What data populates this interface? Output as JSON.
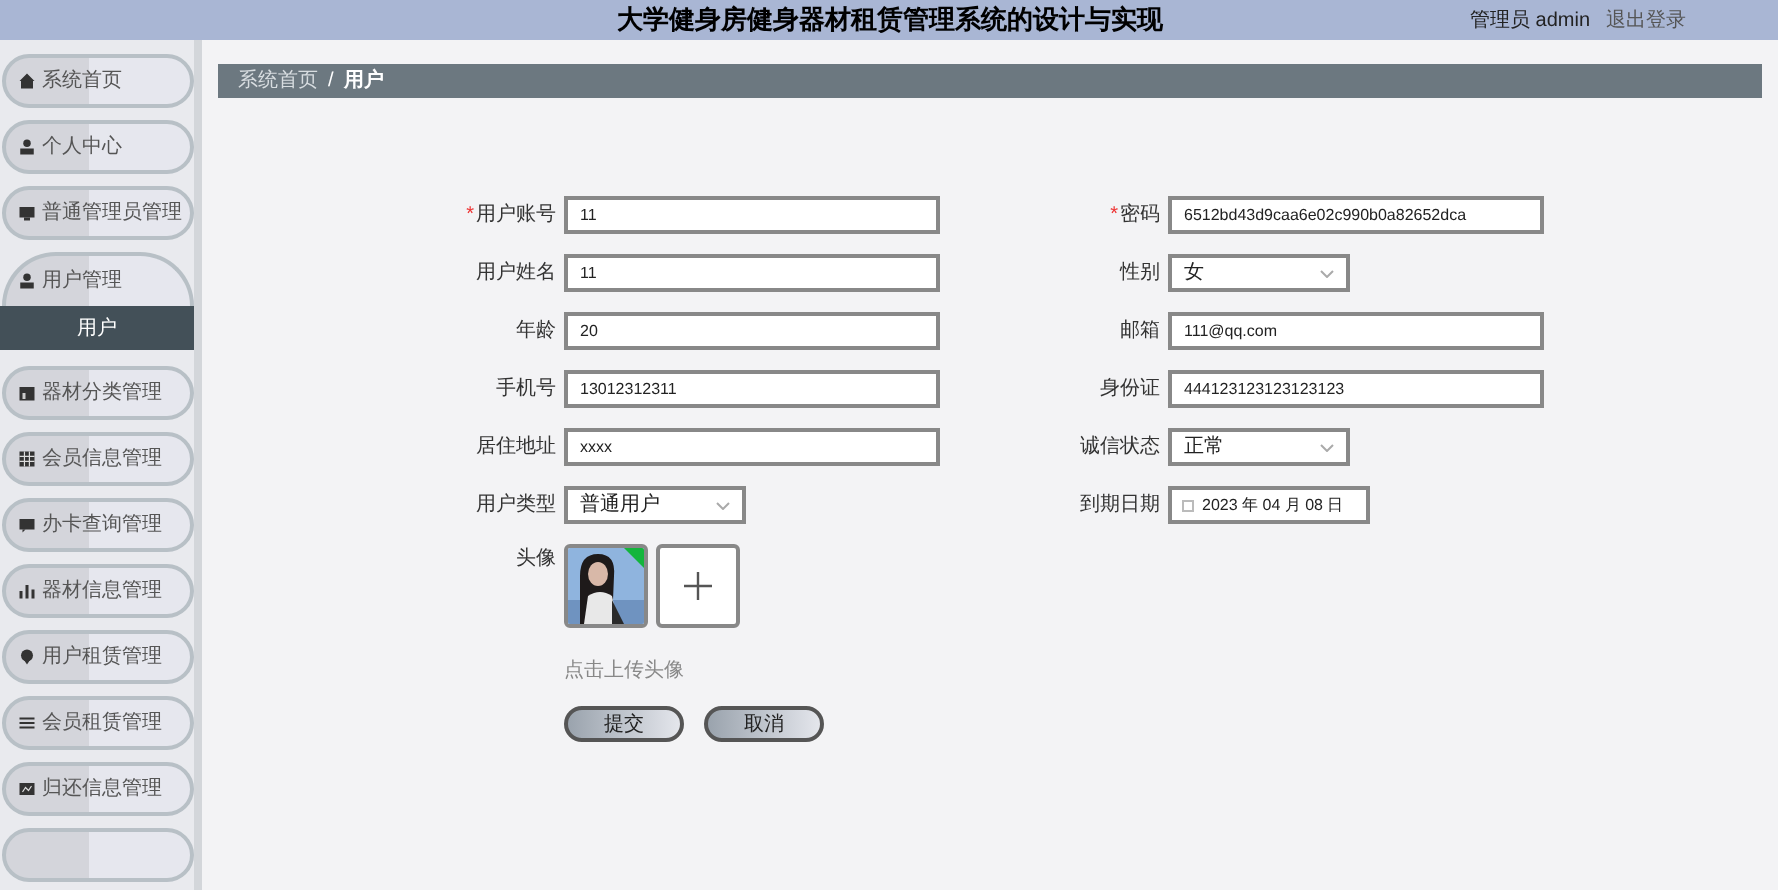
{
  "header": {
    "title": "大学健身房健身器材租赁管理系统的设计与实现",
    "user_label": "管理员 admin",
    "logout": "退出登录"
  },
  "sidebar": {
    "items": [
      {
        "label": "系统首页",
        "expanded": false
      },
      {
        "label": "个人中心",
        "expanded": false
      },
      {
        "label": "普通管理员管理",
        "expanded": false
      },
      {
        "label": "用户管理",
        "expanded": true,
        "children": [
          {
            "label": "用户",
            "selected": true
          }
        ]
      },
      {
        "label": "器材分类管理",
        "expanded": false
      },
      {
        "label": "会员信息管理",
        "expanded": false
      },
      {
        "label": "办卡查询管理",
        "expanded": false
      },
      {
        "label": "器材信息管理",
        "expanded": false
      },
      {
        "label": "用户租赁管理",
        "expanded": false
      },
      {
        "label": "会员租赁管理",
        "expanded": false
      },
      {
        "label": "归还信息管理",
        "expanded": false
      },
      {
        "expanded": false
      }
    ]
  },
  "breadcrumb": {
    "items": [
      "系统首页",
      "用户"
    ],
    "separator": "/"
  },
  "form": {
    "fields": [
      {
        "kind": "input",
        "label": "用户账号",
        "required": true,
        "value": "11"
      },
      {
        "kind": "input",
        "label": "密码",
        "required": true,
        "value": "6512bd43d9caa6e02c990b0a82652dca"
      },
      {
        "kind": "input",
        "label": "用户姓名",
        "required": false,
        "value": "11"
      },
      {
        "kind": "select",
        "label": "性别",
        "required": false,
        "value": "女"
      },
      {
        "kind": "input",
        "label": "年龄",
        "required": false,
        "value": "20"
      },
      {
        "kind": "input",
        "label": "邮箱",
        "required": false,
        "value": "111@qq.com"
      },
      {
        "kind": "input",
        "label": "手机号",
        "required": false,
        "value": "13012312311"
      },
      {
        "kind": "input",
        "label": "身份证",
        "required": false,
        "value": "444123123123123123"
      },
      {
        "kind": "input",
        "label": "居住地址",
        "required": false,
        "value": "xxxx"
      },
      {
        "kind": "select",
        "label": "诚信状态",
        "required": false,
        "value": "正常"
      },
      {
        "kind": "select",
        "label": "用户类型",
        "required": false,
        "value": "普通用户"
      },
      {
        "kind": "date",
        "label": "到期日期",
        "required": false,
        "value": "2023 年 04 月 08 日"
      }
    ],
    "required_mark": "*",
    "avatar": {
      "label": "头像",
      "uploaded": true,
      "hint": "点击上传头像"
    },
    "buttons": [
      "提交",
      "取消"
    ]
  }
}
